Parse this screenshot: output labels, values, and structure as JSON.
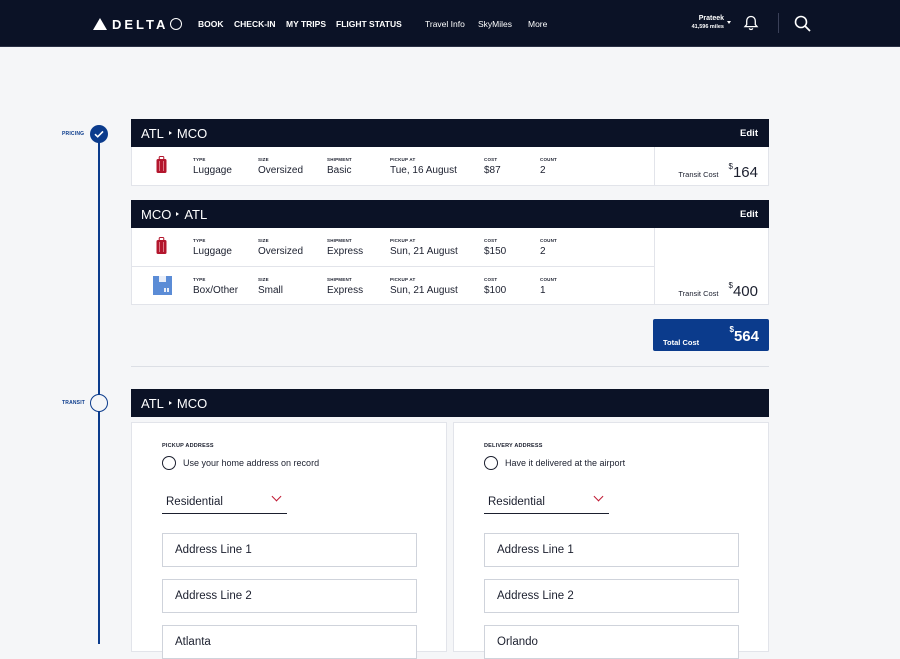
{
  "nav": {
    "brand": "DELTA",
    "links_primary": [
      "BOOK",
      "CHECK-IN",
      "MY TRIPS",
      "FLIGHT STATUS"
    ],
    "links_secondary": [
      "Travel Info",
      "SkyMiles",
      "More"
    ],
    "user_name": "Prateek",
    "user_miles": "41,596 miles"
  },
  "timeline": {
    "step1": "PRICING",
    "step2": "TRANSIT"
  },
  "pricing": {
    "trips": [
      {
        "route_from": "ATL",
        "route_to": "MCO",
        "edit_label": "Edit",
        "transit_label": "Transit Cost",
        "transit_currency": "$",
        "transit_amount": "164",
        "items": [
          {
            "icon": "luggage-icon",
            "type": "Luggage",
            "size": "Oversized",
            "shipment": "Basic",
            "pickup": "Tue, 16 August",
            "cost": "$87",
            "count": "2"
          }
        ]
      },
      {
        "route_from": "MCO",
        "route_to": "ATL",
        "edit_label": "Edit",
        "transit_label": "Transit Cost",
        "transit_currency": "$",
        "transit_amount": "400",
        "items": [
          {
            "icon": "luggage-icon",
            "type": "Luggage",
            "size": "Oversized",
            "shipment": "Express",
            "pickup": "Sun, 21 August",
            "cost": "$150",
            "count": "2"
          },
          {
            "icon": "box-icon",
            "type": "Box/Other",
            "size": "Small",
            "shipment": "Express",
            "pickup": "Sun, 21 August",
            "cost": "$100",
            "count": "1"
          }
        ]
      }
    ],
    "column_labels": {
      "type": "TYPE",
      "size": "SIZE",
      "shipment": "SHIPMENT",
      "pickup": "PICKUP AT",
      "cost": "COST",
      "count": "COUNT"
    },
    "total_label": "Total Cost",
    "total_currency": "$",
    "total_amount": "564"
  },
  "transit": {
    "route_from": "ATL",
    "route_to": "MCO",
    "pickup": {
      "title": "PICKUP ADDRESS",
      "radio_label": "Use your home address on record",
      "select_value": "Residential",
      "address1_placeholder": "Address Line 1",
      "address2_placeholder": "Address Line 2",
      "address3_placeholder": "Atlanta"
    },
    "delivery": {
      "title": "DELIVERY ADDRESS",
      "radio_label": "Have it delivered at the airport",
      "select_value": "Residential",
      "address1_placeholder": "Address Line 1",
      "address2_placeholder": "Address Line 2",
      "address3_placeholder": "Orlando"
    }
  },
  "colors": {
    "navy": "#0b1226",
    "blue": "#0b3b8c",
    "red": "#c01933"
  }
}
